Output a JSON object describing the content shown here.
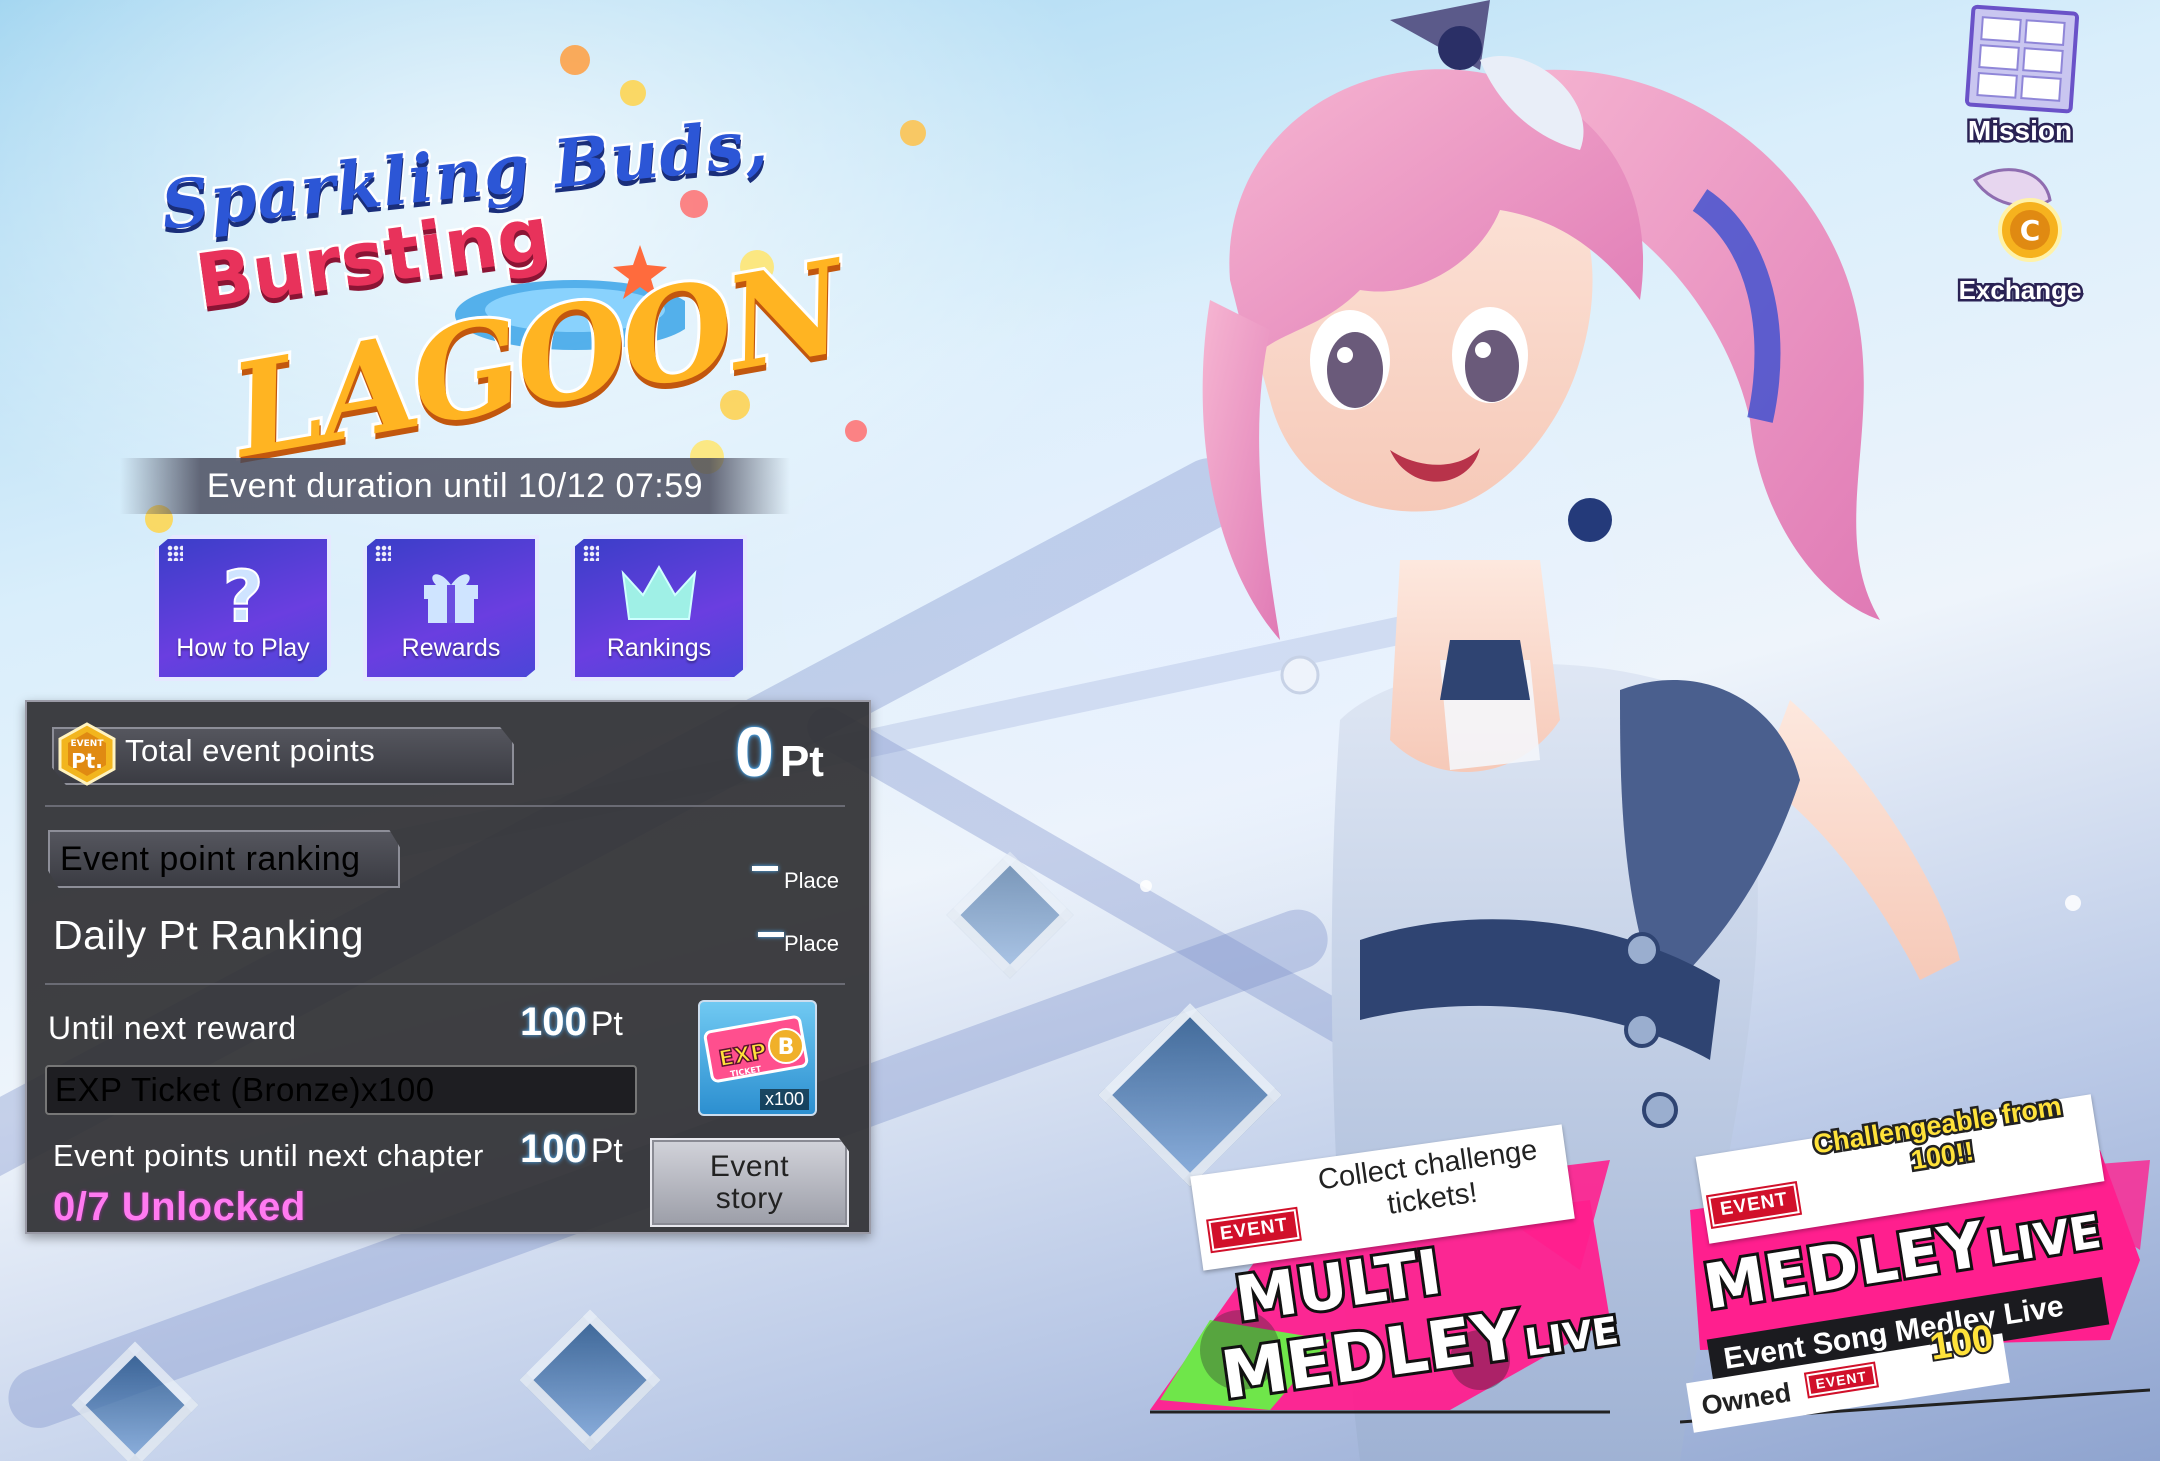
{
  "logo": {
    "line1": "Sparkling Buds,",
    "line2": "Bursting",
    "line3": "LAGOON"
  },
  "event_duration": "Event duration until 10/12 07:59",
  "menu": {
    "how_to_play": "How to Play",
    "rewards": "Rewards",
    "rankings": "Rankings"
  },
  "points": {
    "badge_top": "EVENT",
    "badge_bottom": "Pt.",
    "total_label": "Total event points",
    "total_value": "0",
    "total_unit": "Pt"
  },
  "ranking": {
    "event_label": "Event point ranking",
    "event_value": "–",
    "place_label": "Place",
    "daily_label": "Daily Pt Ranking",
    "daily_value": "–"
  },
  "next_reward": {
    "label": "Until next reward",
    "value": "100",
    "unit": "Pt",
    "item": "EXP Ticket (Bronze)x100",
    "ticket_top": "EXP",
    "ticket_sub": "TICKET",
    "ticket_grade": "B",
    "ticket_qty": "x100"
  },
  "chapter": {
    "label": "Event points until next chapter",
    "value": "100",
    "unit": "Pt",
    "unlocked": "0/7 Unlocked",
    "story_button": "Event story"
  },
  "shortcuts": {
    "mission": "Mission",
    "exchange": "Exchange"
  },
  "multi_medley": {
    "event_tag": "EVENT",
    "banner": "Collect challenge tickets!",
    "title_line1": "MULTI",
    "title_line2": "MEDLEY",
    "title_live": "LIVE"
  },
  "medley_live": {
    "event_tag": "EVENT",
    "banner": "Challengeable from 100!!",
    "title": "MEDLEY",
    "title_live": "LIVE",
    "subtitle": "Event Song Medley Live",
    "owned_label": "Owned",
    "owned_tag": "EVENT",
    "owned_value": "100"
  },
  "colors": {
    "accent_blue": "#4db3ff",
    "unlock_pink": "#ff7af0",
    "event_red": "#d1102a",
    "multi_pink": "#ff1f8e",
    "multi_green": "#6fe64a",
    "medley_yellow": "#ffe23a"
  }
}
